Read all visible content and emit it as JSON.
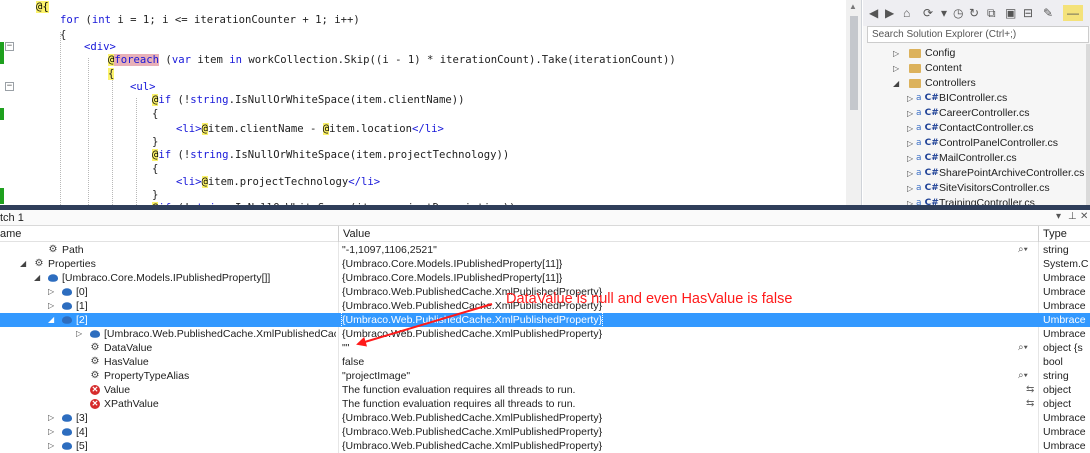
{
  "editor": {
    "lines": [
      {
        "parts": [
          {
            "t": "@{",
            "c": "at"
          }
        ]
      },
      {
        "parts": [
          {
            "t": "for",
            "c": "kw"
          },
          {
            "t": " ("
          },
          {
            "t": "int",
            "c": "kw"
          },
          {
            "t": " i = 1; i <= iterationCounter + 1; i++)"
          }
        ]
      },
      {
        "parts": [
          {
            "t": "{"
          }
        ]
      },
      {
        "parts": [
          {
            "t": "<div>",
            "c": "kw"
          }
        ]
      },
      {
        "parts": [
          {
            "t": "@",
            "c": "at"
          },
          {
            "t": "foreach",
            "c": "fe"
          },
          {
            "t": " ("
          },
          {
            "t": "var",
            "c": "kw"
          },
          {
            "t": " item "
          },
          {
            "t": "in",
            "c": "kw"
          },
          {
            "t": " workCollection.Skip((i - 1) * iterationCount).Take(iterationCount))"
          }
        ]
      },
      {
        "parts": [
          {
            "t": "{",
            "c": "brace-hl"
          }
        ]
      },
      {
        "parts": [
          {
            "t": "<ul>",
            "c": "kw"
          }
        ]
      },
      {
        "parts": [
          {
            "t": "@",
            "c": "at"
          },
          {
            "t": "if",
            "c": "kw"
          },
          {
            "t": " (!"
          },
          {
            "t": "string",
            "c": "kw"
          },
          {
            "t": ".IsNullOrWhiteSpace(item.clientName))"
          }
        ]
      },
      {
        "parts": [
          {
            "t": "{"
          }
        ]
      },
      {
        "parts": [
          {
            "t": "<li>",
            "c": "kw"
          },
          {
            "t": "@",
            "c": "at"
          },
          {
            "t": "item.clientName - "
          },
          {
            "t": "@",
            "c": "at"
          },
          {
            "t": "item.location"
          },
          {
            "t": "</li>",
            "c": "kw"
          }
        ]
      },
      {
        "parts": [
          {
            "t": "}"
          }
        ]
      },
      {
        "parts": [
          {
            "t": "@",
            "c": "at"
          },
          {
            "t": "if",
            "c": "kw"
          },
          {
            "t": " (!"
          },
          {
            "t": "string",
            "c": "kw"
          },
          {
            "t": ".IsNullOrWhiteSpace(item.projectTechnology))"
          }
        ]
      },
      {
        "parts": [
          {
            "t": "{"
          }
        ]
      },
      {
        "parts": [
          {
            "t": "<li>",
            "c": "kw"
          },
          {
            "t": "@",
            "c": "at"
          },
          {
            "t": "item.projectTechnology"
          },
          {
            "t": "</li>",
            "c": "kw"
          }
        ]
      },
      {
        "parts": [
          {
            "t": "}"
          }
        ]
      },
      {
        "parts": [
          {
            "t": "@",
            "c": "at"
          },
          {
            "t": "if",
            "c": "kw"
          },
          {
            "t": " (!"
          },
          {
            "t": "string",
            "c": "kw"
          },
          {
            "t": ".IsNullOrWhiteSpace(item.projectDescription))"
          }
        ]
      }
    ]
  },
  "solution": {
    "search_placeholder": "Search Solution Explorer (Ctrl+;)",
    "items": [
      {
        "label": "Config",
        "kind": "folder",
        "expanded": false
      },
      {
        "label": "Content",
        "kind": "folder",
        "expanded": false
      },
      {
        "label": "Controllers",
        "kind": "folder",
        "expanded": true
      },
      {
        "label": "BIController.cs",
        "kind": "cs"
      },
      {
        "label": "CareerController.cs",
        "kind": "cs"
      },
      {
        "label": "ContactController.cs",
        "kind": "cs"
      },
      {
        "label": "ControlPanelController.cs",
        "kind": "cs"
      },
      {
        "label": "MailController.cs",
        "kind": "cs"
      },
      {
        "label": "SharePointArchiveController.cs",
        "kind": "cs"
      },
      {
        "label": "SiteVisitorsController.cs",
        "kind": "cs"
      },
      {
        "label": "TrainingController.cs",
        "kind": "cs"
      }
    ]
  },
  "watch": {
    "title": "tch 1",
    "col_name": "ame",
    "col_value": "Value",
    "col_type": "Type",
    "rows": [
      {
        "indent": 1,
        "exp": "",
        "icon": "prop",
        "name": "Path",
        "value": "\"-1,1097,1106,2521\"",
        "mag": true,
        "type": "string"
      },
      {
        "indent": 0,
        "exp": "open",
        "icon": "prop",
        "name": "Properties",
        "value": "{Umbraco.Core.Models.IPublishedProperty[11]}",
        "type": "System.C"
      },
      {
        "indent": 1,
        "exp": "open",
        "icon": "obj",
        "name": "[Umbraco.Core.Models.IPublishedProperty[]]",
        "value": "{Umbraco.Core.Models.IPublishedProperty[11]}",
        "type": "Umbrace"
      },
      {
        "indent": 2,
        "exp": "closed",
        "icon": "obj",
        "name": "[0]",
        "value": "{Umbraco.Web.PublishedCache.XmlPublishedProperty}",
        "type": "Umbrace"
      },
      {
        "indent": 2,
        "exp": "closed",
        "icon": "obj",
        "name": "[1]",
        "value": "{Umbraco.Web.PublishedCache.XmlPublishedProperty}",
        "type": "Umbrace"
      },
      {
        "indent": 2,
        "exp": "open",
        "icon": "obj",
        "name": "[2]",
        "value": "{Umbraco.Web.PublishedCache.XmlPublishedProperty}",
        "type": "Umbrace",
        "selected": true
      },
      {
        "indent": 3,
        "exp": "closed",
        "icon": "obj",
        "name": "[Umbraco.Web.PublishedCache.XmlPublishedCache.)",
        "value": "{Umbraco.Web.PublishedCache.XmlPublishedProperty}",
        "type": "Umbrace"
      },
      {
        "indent": 3,
        "exp": "",
        "icon": "prop",
        "name": "DataValue",
        "value": "\"\"",
        "mag": true,
        "type": "object {s"
      },
      {
        "indent": 3,
        "exp": "",
        "icon": "prop",
        "name": "HasValue",
        "value": "false",
        "type": "bool"
      },
      {
        "indent": 3,
        "exp": "",
        "icon": "prop",
        "name": "PropertyTypeAlias",
        "value": "\"projectImage\"",
        "mag": true,
        "type": "string"
      },
      {
        "indent": 3,
        "exp": "",
        "icon": "err",
        "name": "Value",
        "value": "The function evaluation requires all threads to run.",
        "recalc": true,
        "type": "object"
      },
      {
        "indent": 3,
        "exp": "",
        "icon": "err",
        "name": "XPathValue",
        "value": "The function evaluation requires all threads to run.",
        "recalc": true,
        "type": "object"
      },
      {
        "indent": 2,
        "exp": "closed",
        "icon": "obj",
        "name": "[3]",
        "value": "{Umbraco.Web.PublishedCache.XmlPublishedProperty}",
        "type": "Umbrace"
      },
      {
        "indent": 2,
        "exp": "closed",
        "icon": "obj",
        "name": "[4]",
        "value": "{Umbraco.Web.PublishedCache.XmlPublishedProperty}",
        "type": "Umbrace"
      },
      {
        "indent": 2,
        "exp": "closed",
        "icon": "obj",
        "name": "[5]",
        "value": "{Umbraco.Web.PublishedCache.XmlPublishedProperty}",
        "type": "Umbrace"
      }
    ]
  },
  "annotation": {
    "text": "DataValue is null and even HasValue is false",
    "color": "#ff1a1a"
  },
  "colors": {
    "selection": "#3399ff",
    "splitter": "#2f3e5a",
    "keyword": "#1717d9",
    "razor_highlight": "#fcf36b"
  }
}
